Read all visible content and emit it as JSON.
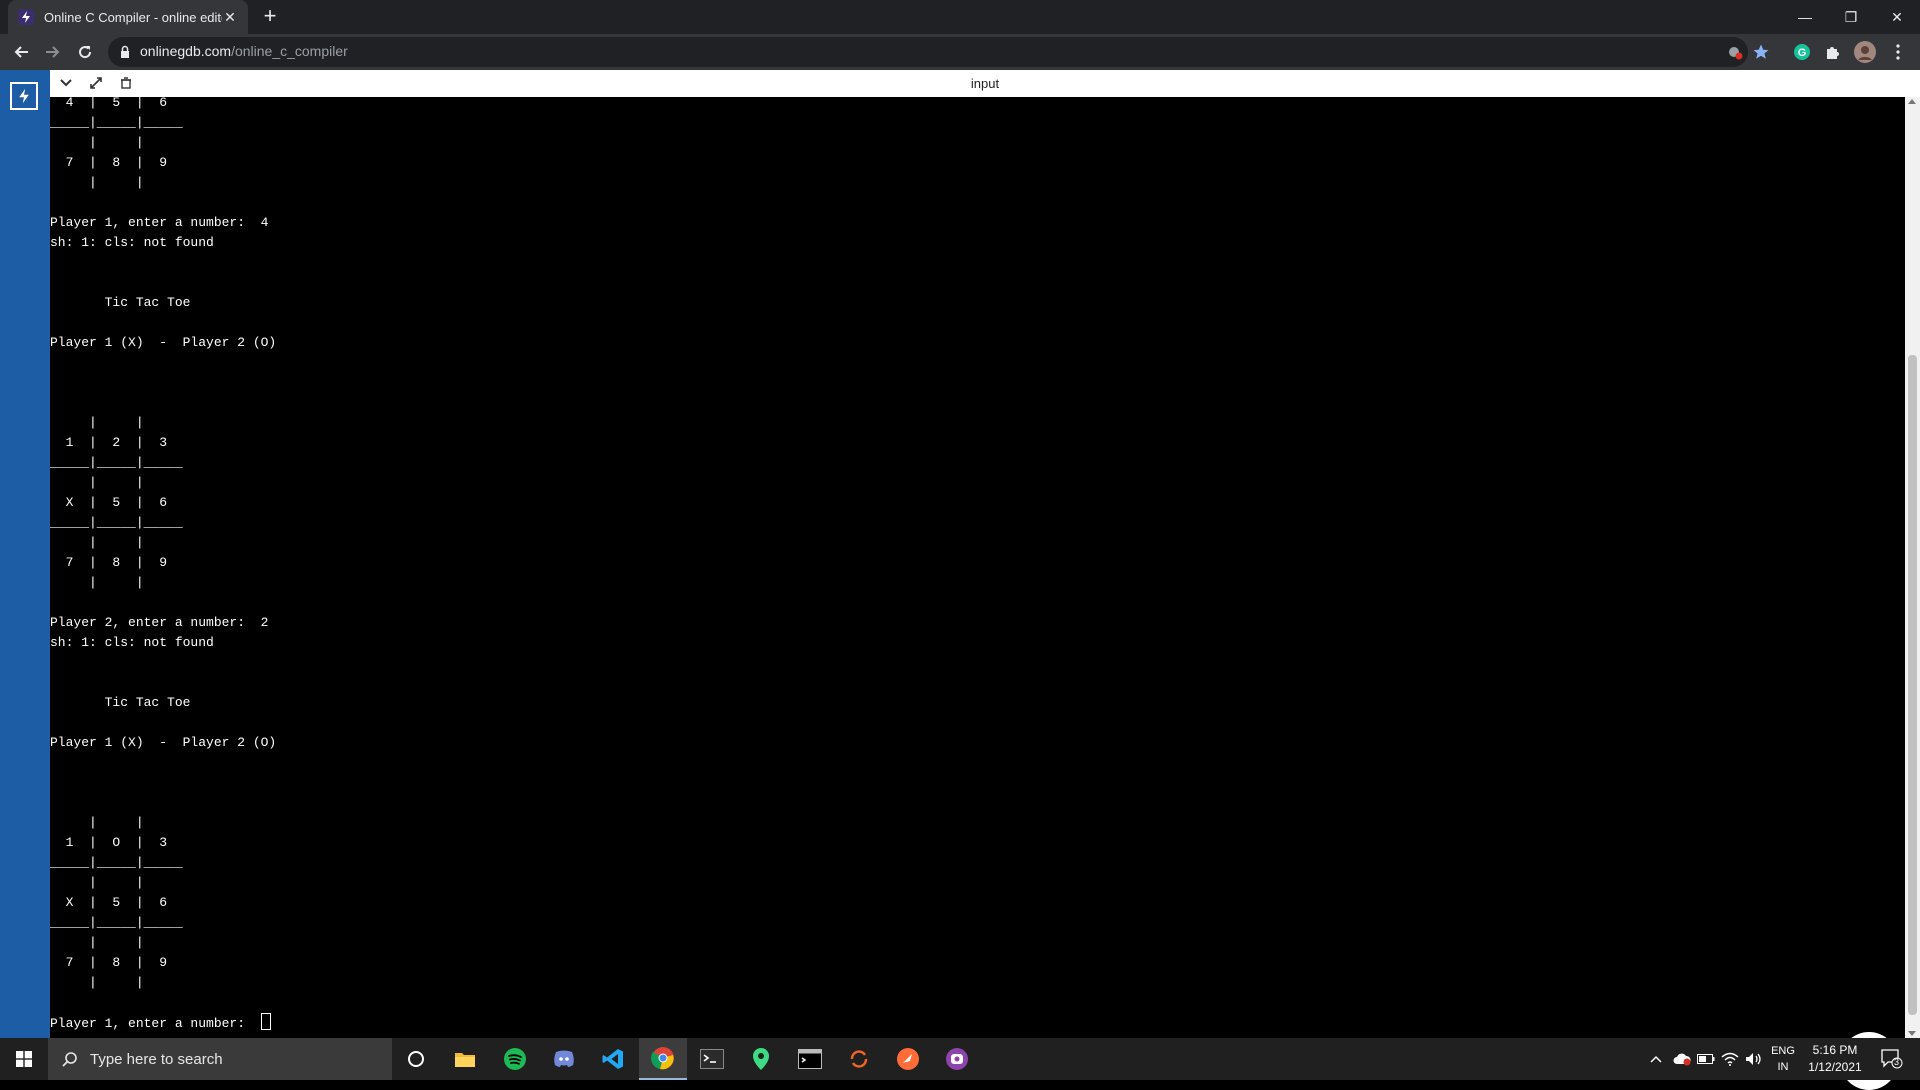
{
  "browser": {
    "tab_title": "Online C Compiler - online editor",
    "tab_close": "✕",
    "new_tab": "+",
    "url_host": "onlinegdb.com",
    "url_path": "/online_c_compiler",
    "window_minimize": "—",
    "window_restore": "❐",
    "window_close": "✕"
  },
  "panel": {
    "title": "input"
  },
  "console": {
    "lines": [
      "_____|_____|_____",
      "     |     |",
      "  4  |  5  |  6",
      "_____|_____|_____",
      "     |     |",
      "  7  |  8  |  9",
      "     |     |",
      "",
      "Player 1, enter a number:  4",
      "sh: 1: cls: not found",
      "",
      "",
      "       Tic Tac Toe",
      "",
      "Player 1 (X)  -  Player 2 (O)",
      "",
      "",
      "",
      "     |     |",
      "  1  |  2  |  3",
      "_____|_____|_____",
      "     |     |",
      "  X  |  5  |  6",
      "_____|_____|_____",
      "     |     |",
      "  7  |  8  |  9",
      "     |     |",
      "",
      "Player 2, enter a number:  2",
      "sh: 1: cls: not found",
      "",
      "",
      "       Tic Tac Toe",
      "",
      "Player 1 (X)  -  Player 2 (O)",
      "",
      "",
      "",
      "     |     |",
      "  1  |  O  |  3",
      "_____|_____|_____",
      "     |     |",
      "  X  |  5  |  6",
      "_____|_____|_____",
      "     |     |",
      "  7  |  8  |  9",
      "     |     |",
      ""
    ],
    "prompt": "Player 1, enter a number:  "
  },
  "taskbar": {
    "search_placeholder": "Type here to search",
    "lang_line1": "ENG",
    "lang_line2": "IN",
    "time": "5:16 PM",
    "date": "1/12/2021",
    "notification_count": "3"
  },
  "colors": {
    "side_rail": "#1c5da6",
    "chrome_dark": "#202124",
    "chrome_toolbar": "#35363a",
    "chat_green": "#2ec27e"
  }
}
